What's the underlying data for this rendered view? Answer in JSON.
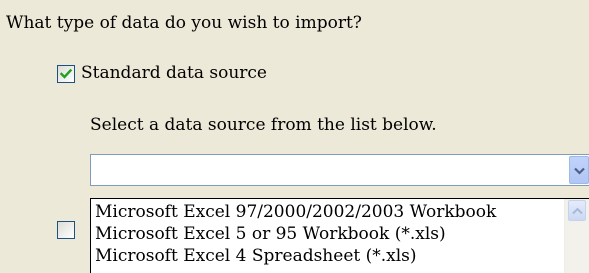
{
  "question": "What type of data do you wish to import?",
  "standard": {
    "label": "Standard data source",
    "checked": true
  },
  "instruction": "Select a data source from the list below.",
  "combo": {
    "value": ""
  },
  "dropdown": {
    "items": [
      "Microsoft Excel 97/2000/2002/2003 Workbook",
      "Microsoft Excel 5 or 95 Workbook (*.xls)",
      "Microsoft Excel 4 Spreadsheet (*.xls)"
    ]
  },
  "other": {
    "checked": false
  },
  "colors": {
    "dialog_bg": "#ece9d8",
    "check_green": "#21a121",
    "combo_arrow": "#4d6185"
  },
  "icons": {
    "check": "checkmark-icon",
    "combo_arrow": "chevron-down-icon",
    "scroll_up": "chevron-up-icon"
  }
}
